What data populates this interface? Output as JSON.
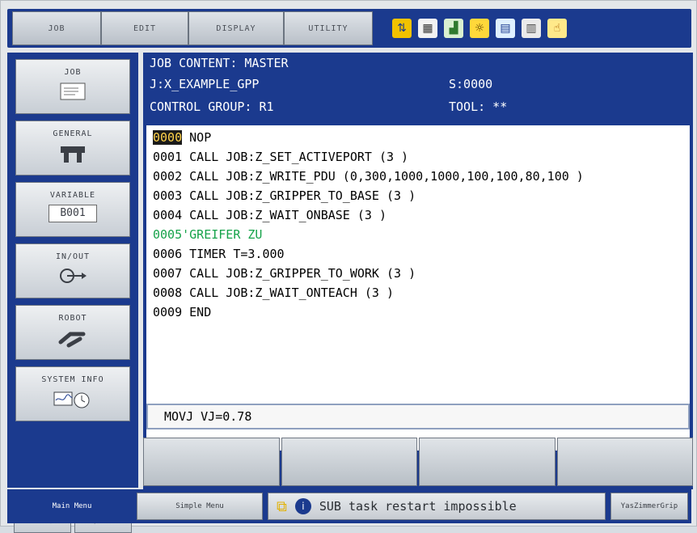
{
  "menu": [
    "JOB",
    "EDIT",
    "DISPLAY",
    "UTILITY"
  ],
  "icons": [
    "mode-switch-icon",
    "document-icon",
    "chart-icon",
    "stamp-icon",
    "calendar-icon",
    "folder-icon",
    "hand-icon"
  ],
  "sidebar": {
    "items": [
      {
        "label": "JOB",
        "icon": "job-doc-icon"
      },
      {
        "label": "GENERAL",
        "icon": "gripper-icon"
      },
      {
        "label": "VARIABLE",
        "badge": "B001"
      },
      {
        "label": "IN/OUT",
        "icon": "io-icon"
      },
      {
        "label": "ROBOT",
        "icon": "robot-icon"
      },
      {
        "label": "SYSTEM INFO",
        "icon": "system-info-icon"
      }
    ]
  },
  "header": {
    "title": "JOB CONTENT: MASTER",
    "job": "J:X_EXAMPLE_GPP",
    "control": "CONTROL GROUP: R1",
    "step": "S:0000",
    "tool": "TOOL: **"
  },
  "lines": [
    {
      "num": "0000",
      "text": "NOP",
      "hl": true
    },
    {
      "num": "0001",
      "text": "CALL JOB:Z_SET_ACTIVEPORT (3 )"
    },
    {
      "num": "0002",
      "text": "CALL JOB:Z_WRITE_PDU (0,300,1000,1000,100,100,80,100 )"
    },
    {
      "num": "0003",
      "text": "CALL JOB:Z_GRIPPER_TO_BASE (3 )"
    },
    {
      "num": "0004",
      "text": "CALL JOB:Z_WAIT_ONBASE (3 )"
    },
    {
      "num": "0005",
      "text": "'GREIFER ZU",
      "comment": true
    },
    {
      "num": "0006",
      "text": "TIMER T=3.000"
    },
    {
      "num": "0007",
      "text": "CALL JOB:Z_GRIPPER_TO_WORK (3 )"
    },
    {
      "num": "0008",
      "text": "CALL JOB:Z_WAIT_ONTEACH (3 )"
    },
    {
      "num": "0009",
      "text": "END"
    }
  ],
  "edit_line": "MOVJ VJ=0.78",
  "bottom": {
    "main_menu": "Main Menu",
    "simple_menu": "Simple Menu",
    "message": "SUB task restart impossible",
    "right": "YasZimmerGrip"
  },
  "colors": {
    "panel": "#1b3a8e",
    "comment": "#16a34a",
    "highlight_fg": "#ffd24a"
  }
}
